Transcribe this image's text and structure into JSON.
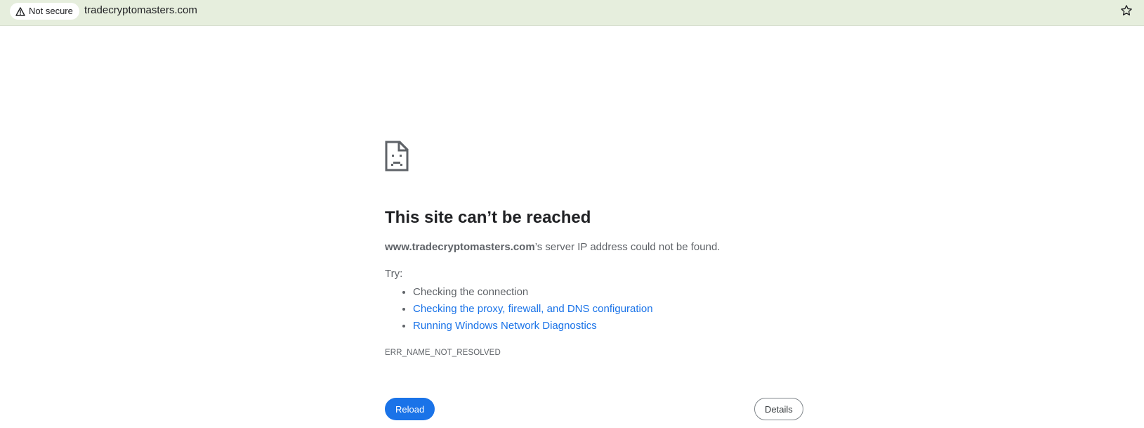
{
  "address_bar": {
    "security_label": "Not secure",
    "url": "tradecryptomasters.com",
    "security_icon": "warning-triangle-icon",
    "bookmark_icon": "star-outline-icon"
  },
  "error_page": {
    "icon": "sad-document-icon",
    "title": "This site can’t be reached",
    "host": "www.tradecryptomasters.com",
    "message_suffix": "’s server IP address could not be found.",
    "try_label": "Try:",
    "suggestions": [
      {
        "text": "Checking the connection",
        "is_link": false
      },
      {
        "text": "Checking the proxy, firewall, and DNS configuration",
        "is_link": true
      },
      {
        "text": "Running Windows Network Diagnostics",
        "is_link": true
      }
    ],
    "error_code": "ERR_NAME_NOT_RESOLVED",
    "reload_label": "Reload",
    "details_label": "Details"
  },
  "colors": {
    "toolbar_bg": "#e6eedd",
    "link": "#1a73e8",
    "primary_button": "#1a73e8",
    "text_primary": "#202124",
    "text_secondary": "#5f6368"
  }
}
